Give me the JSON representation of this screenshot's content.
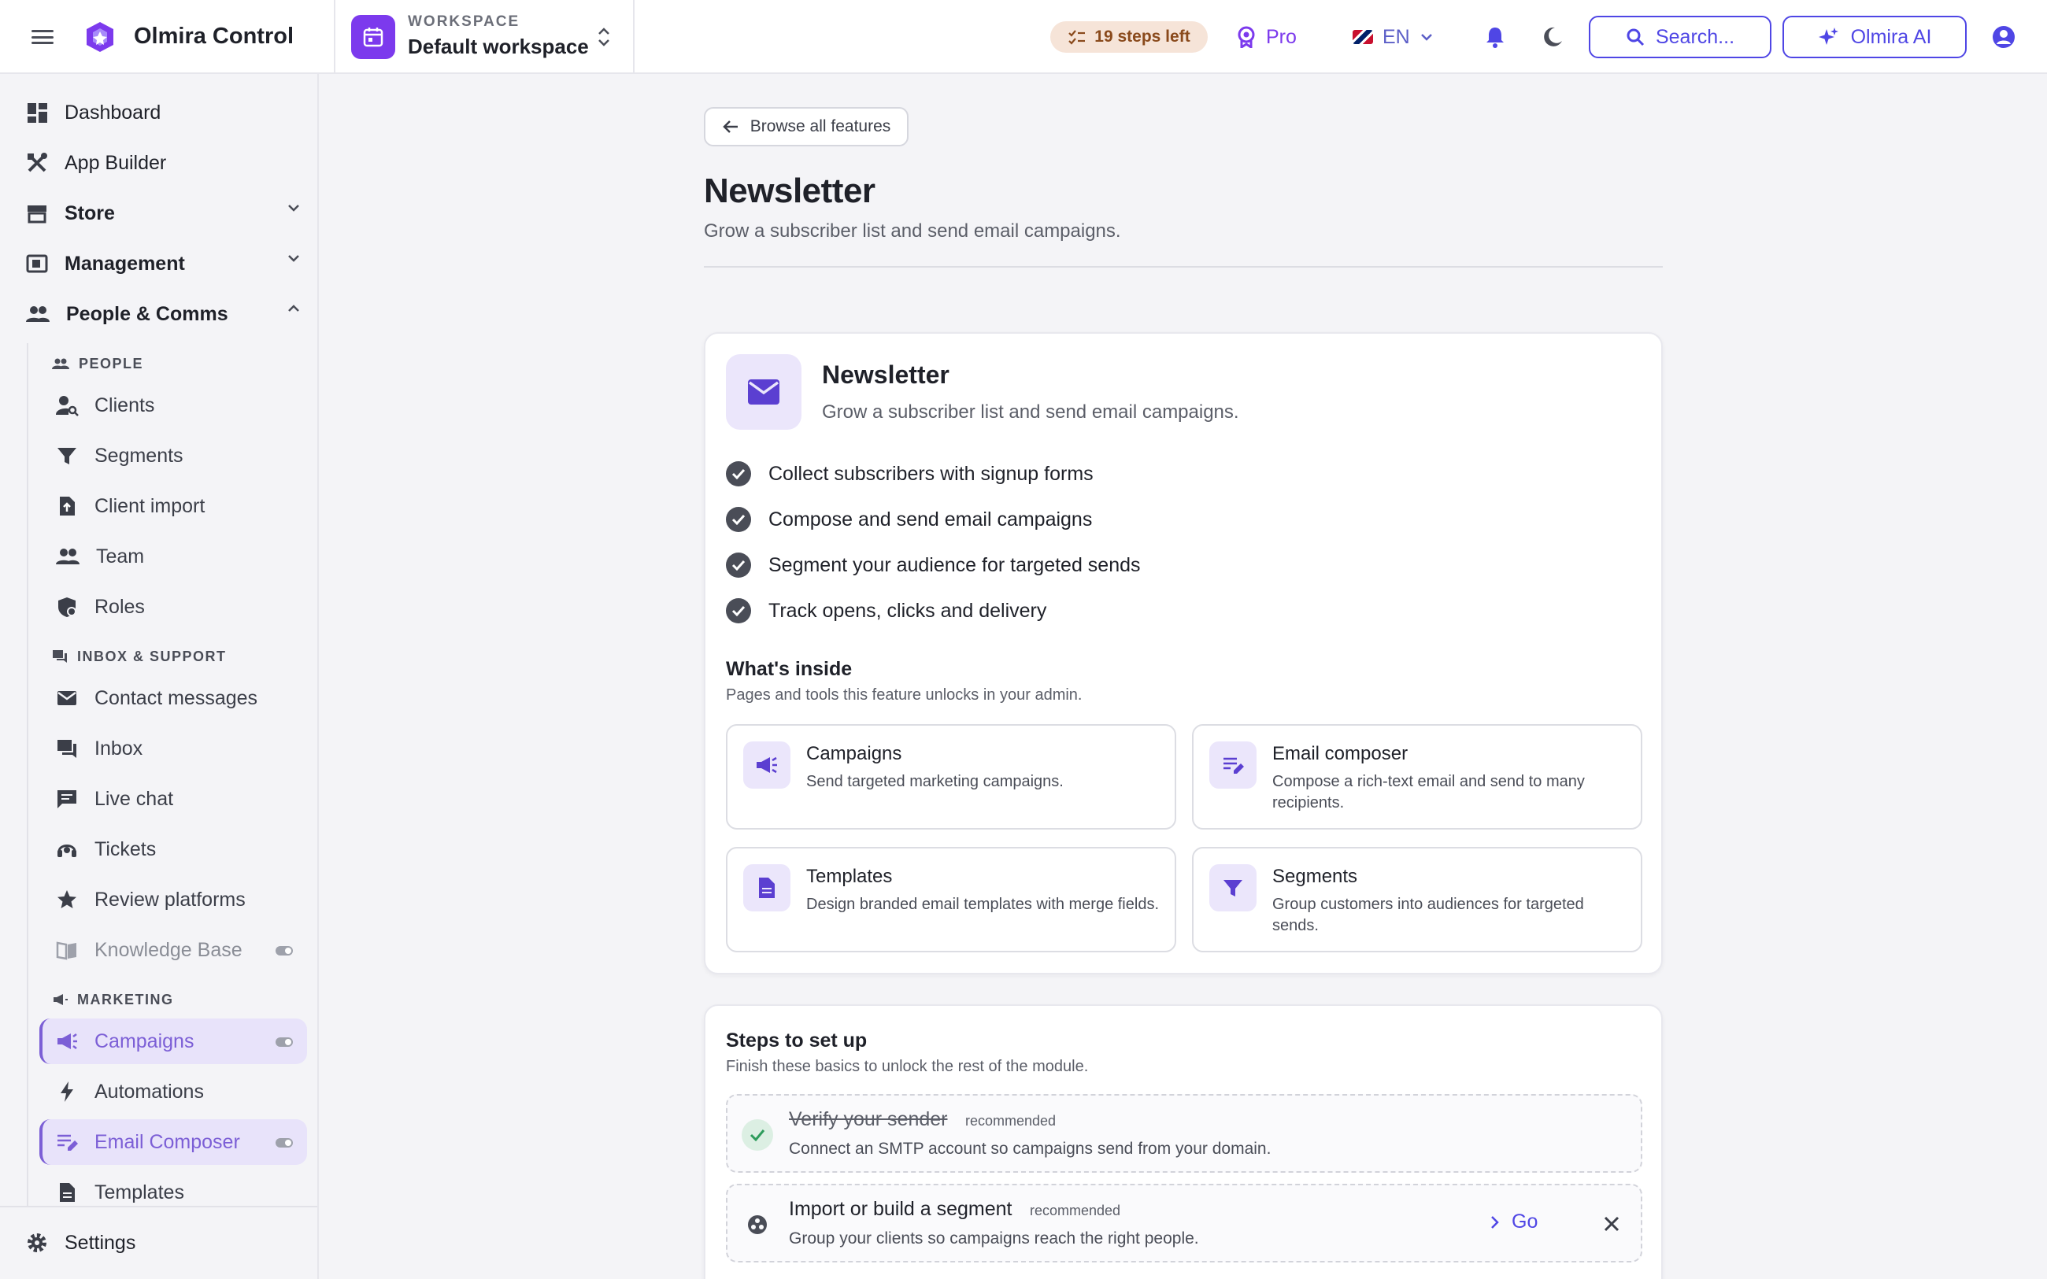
{
  "app": {
    "brand": "Olmira Control"
  },
  "workspace": {
    "label": "WORKSPACE",
    "name": "Default workspace"
  },
  "header": {
    "steps_left": "19 steps left",
    "plan": "Pro",
    "language": "EN",
    "search_label": "Search...",
    "ai_label": "Olmira AI"
  },
  "sidebar": {
    "top": [
      {
        "label": "Dashboard"
      },
      {
        "label": "App Builder"
      },
      {
        "label": "Store"
      },
      {
        "label": "Management"
      },
      {
        "label": "People & Comms"
      }
    ],
    "sections": {
      "people": "PEOPLE",
      "inbox": "INBOX & SUPPORT",
      "marketing": "MARKETING"
    },
    "people_items": [
      "Clients",
      "Segments",
      "Client import",
      "Team",
      "Roles"
    ],
    "inbox_items": [
      "Contact messages",
      "Inbox",
      "Live chat",
      "Tickets",
      "Review platforms",
      "Knowledge Base"
    ],
    "marketing_items": [
      "Campaigns",
      "Automations",
      "Email Composer",
      "Templates"
    ],
    "settings": "Settings"
  },
  "main": {
    "back_label": "Browse all features",
    "title": "Newsletter",
    "subtitle": "Grow a subscriber list and send email campaigns.",
    "hero": {
      "title": "Newsletter",
      "subtitle": "Grow a subscriber list and send email campaigns.",
      "features": [
        "Collect subscribers with signup forms",
        "Compose and send email campaigns",
        "Segment your audience for targeted sends",
        "Track opens, clicks and delivery"
      ]
    },
    "inside": {
      "title": "What's inside",
      "subtitle": "Pages and tools this feature unlocks in your admin.",
      "tiles": [
        {
          "title": "Campaigns",
          "desc": "Send targeted marketing campaigns.",
          "icon": "megaphone-icon"
        },
        {
          "title": "Email composer",
          "desc": "Compose a rich-text email and send to many recipients.",
          "icon": "edit-list-icon"
        },
        {
          "title": "Templates",
          "desc": "Design branded email templates with merge fields.",
          "icon": "document-icon"
        },
        {
          "title": "Segments",
          "desc": "Group customers into audiences for targeted sends.",
          "icon": "filter-icon"
        }
      ]
    },
    "steps": {
      "title": "Steps to set up",
      "subtitle": "Finish these basics to unlock the rest of the module.",
      "items": [
        {
          "title": "Verify your sender",
          "tag": "recommended",
          "desc": "Connect an SMTP account so campaigns send from your domain.",
          "done": true
        },
        {
          "title": "Import or build a segment",
          "tag": "recommended",
          "desc": "Group your clients so campaigns reach the right people.",
          "done": false,
          "action": "Go"
        }
      ]
    }
  },
  "colors": {
    "accent": "#4f46e5",
    "brand_purple": "#7c3aed",
    "tile_icon_bg": "#ebe6fb",
    "steps_pill_bg": "#f6e4d8",
    "done_green": "#2e9c5c"
  }
}
